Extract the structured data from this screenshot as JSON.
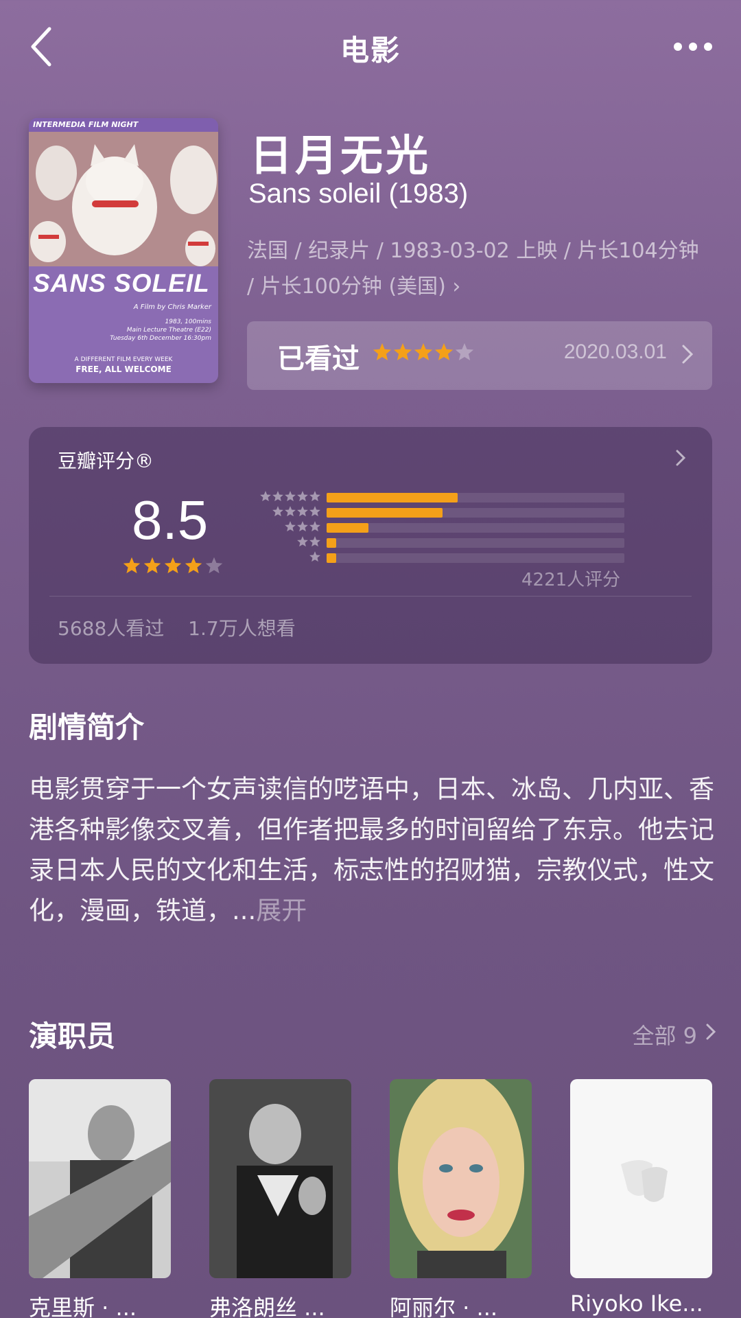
{
  "header": {
    "title": "电影"
  },
  "poster": {
    "top_text": "INTERMEDIA FILM NIGHT",
    "title": "SANS SOLEIL",
    "credit": "A Film by Chris Marker",
    "info_line1": "1983, 100mins",
    "info_line2": "Main Lecture Theatre (E22)",
    "info_line3": "Tuesday 6th December 16:30pm",
    "foot_line1": "A DIFFERENT FILM EVERY WEEK",
    "foot_line2": "FREE, ALL WELCOME"
  },
  "movie": {
    "title": "日月无光",
    "original_title": "Sans soleil (1983)",
    "meta": "法国 / 纪录片 / 1983-03-02 上映 / 片长104分钟 / 片长100分钟 (美国)",
    "meta_chevron": "›"
  },
  "my_rating": {
    "label": "已看过",
    "stars": 4,
    "date": "2020.03.01"
  },
  "douban": {
    "label": "豆瓣评分®",
    "score": "8.5",
    "stars": 4,
    "distribution": [
      {
        "stars": 5,
        "fraction": 0.44
      },
      {
        "stars": 4,
        "fraction": 0.39
      },
      {
        "stars": 3,
        "fraction": 0.14
      },
      {
        "stars": 2,
        "fraction": 0.03
      },
      {
        "stars": 1,
        "fraction": 0.03
      }
    ],
    "count": "4221人评分",
    "watched": "5688人看过",
    "want": "1.7万人想看"
  },
  "synopsis": {
    "title": "剧情简介",
    "text": "电影贯穿于一个女声读信的呓语中，日本、冰岛、几内亚、香港各种影像交叉着，但作者把最多的时间留给了东京。他去记录日本人民的文化和生活，标志性的招财猫，宗教仪式，性文化，漫画，铁道，...",
    "expand": "展开"
  },
  "cast": {
    "title": "演职员",
    "all_label": "全部 9",
    "members": [
      {
        "name": "克里斯 · ..."
      },
      {
        "name": "弗洛朗丝 ..."
      },
      {
        "name": "阿丽尔 · ..."
      },
      {
        "name": "Riyoko Ike..."
      }
    ]
  },
  "colors": {
    "accent_star": "#f4a019",
    "background": "#7c5f8f"
  }
}
